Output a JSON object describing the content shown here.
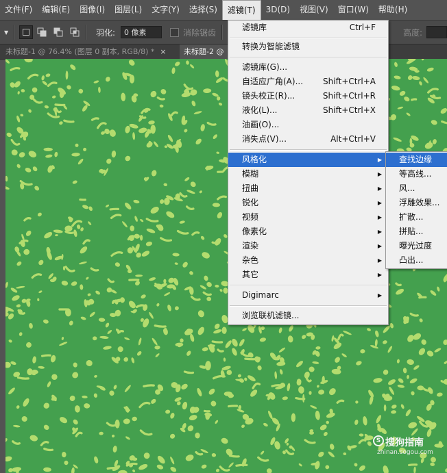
{
  "menubar": {
    "items": [
      "文件(F)",
      "编辑(E)",
      "图像(I)",
      "图层(L)",
      "文字(Y)",
      "选择(S)",
      "滤镜(T)",
      "3D(D)",
      "视图(V)",
      "窗口(W)",
      "帮助(H)"
    ],
    "active": "滤镜(T)"
  },
  "options": {
    "feather_label": "羽化:",
    "feather_value": "0 像素",
    "antialias_label": "消除锯齿",
    "height_label": "高度:"
  },
  "tabs": [
    {
      "label": "未标题-1 @ 76.4% (图层 0 副本, RGB/8) *",
      "close": "×",
      "active": false
    },
    {
      "label": "未标题-2 @",
      "close": "",
      "active": true
    }
  ],
  "filter_menu": {
    "items": [
      {
        "label": "滤镜库",
        "shortcut": "Ctrl+F"
      },
      {
        "label": "转换为智能滤镜",
        "shortcut": ""
      },
      {
        "label": "滤镜库(G)...",
        "shortcut": ""
      },
      {
        "label": "自适应广角(A)...",
        "shortcut": "Shift+Ctrl+A"
      },
      {
        "label": "镜头校正(R)...",
        "shortcut": "Shift+Ctrl+R"
      },
      {
        "label": "液化(L)...",
        "shortcut": "Shift+Ctrl+X"
      },
      {
        "label": "油画(O)...",
        "shortcut": ""
      },
      {
        "label": "消失点(V)...",
        "shortcut": "Alt+Ctrl+V"
      },
      {
        "label": "风格化",
        "shortcut": "",
        "submenu": true,
        "highlighted": true
      },
      {
        "label": "模糊",
        "submenu": true
      },
      {
        "label": "扭曲",
        "submenu": true
      },
      {
        "label": "锐化",
        "submenu": true
      },
      {
        "label": "视频",
        "submenu": true
      },
      {
        "label": "像素化",
        "submenu": true
      },
      {
        "label": "渲染",
        "submenu": true
      },
      {
        "label": "杂色",
        "submenu": true
      },
      {
        "label": "其它",
        "submenu": true
      },
      {
        "label": "Digimarc",
        "submenu": true
      },
      {
        "label": "浏览联机滤镜...",
        "shortcut": ""
      }
    ]
  },
  "stylize_submenu": {
    "items": [
      "查找边缘",
      "等高线...",
      "风...",
      "浮雕效果...",
      "扩散...",
      "拼贴...",
      "曝光过度",
      "凸出..."
    ],
    "highlighted": "查找边缘"
  },
  "colors": {
    "canvas_green": "#44a04e",
    "blob_yellow": "#b4dc6e",
    "highlight_blue": "#2d6fcf"
  },
  "watermark": {
    "main": "搜狗指南",
    "sub": "zhinan.sogou.com"
  }
}
